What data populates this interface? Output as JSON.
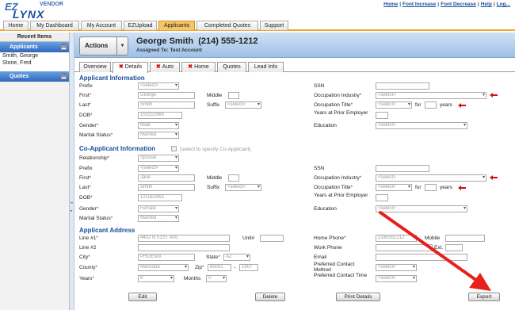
{
  "header": {
    "logo_ez": "EZ",
    "logo_lynx": "LYNX",
    "logo_vendor": "VENDOR",
    "links": [
      "Home",
      "Font Increase",
      "Font Decrease",
      "Help",
      "Log..."
    ],
    "separator": "|"
  },
  "nav": {
    "tabs": [
      "Home",
      "My Dashboard",
      "My Account",
      "EZUpload",
      "Applicants",
      "Completed Quotes",
      "Support"
    ],
    "active": "Applicants"
  },
  "sidebar": {
    "recent_title": "Recent Items",
    "applicants_label": "Applicants",
    "applicants": [
      "Smith, George",
      "Stone, Fred"
    ],
    "quotes_label": "Quotes",
    "collapse_symbol": "⊟"
  },
  "band": {
    "actions_label": "Actions",
    "dropdown_symbol": "▼",
    "client_name": "George Smith",
    "client_phone": "(214) 555-1212",
    "assigned_to": "Assigned To: Test Account"
  },
  "subtabs": {
    "tabs": [
      "Overview",
      "Details",
      "Auto",
      "Home",
      "Quotes",
      "Lead Info"
    ],
    "x_mark": "✖",
    "active": "Details"
  },
  "form": {
    "required_mark": "*",
    "applicant_title": "Applicant Information",
    "coapplicant_title": "Co-Applicant Information",
    "coapplicant_note": "(select to specify Co-Applicant)",
    "address_title": "Applicant Address",
    "labels": {
      "prefix": "Prefix",
      "first": "First",
      "middle": "Middle",
      "last": "Last",
      "suffix": "Suffix",
      "dob": "DOB",
      "gender": "Gender",
      "marital": "Marital Status",
      "ssn": "SSN",
      "occ_industry": "Occupation Industry",
      "occ_title": "Occupation Title",
      "for": "for",
      "years": "years",
      "years_prior": "Years at Prior Employer",
      "education": "Education",
      "relationship": "Relationship",
      "line1": "Line #1",
      "line2": "Line #2",
      "unit": "Unit#",
      "city": "City",
      "state": "State",
      "county": "County",
      "zip": "Zip",
      "years_addr": "Years",
      "months": "Months",
      "home_phone": "Home Phone",
      "mobile": "Mobile",
      "work_phone": "Work Phone",
      "ext": "Ext.",
      "email": "Email",
      "pref_method": "Preferred Contact Method",
      "pref_time": "Preferred Contact Time"
    },
    "applicant": {
      "prefix": "<select>",
      "first": "George",
      "middle": "",
      "last": "Smith",
      "suffix": "<select>",
      "dob": "10/22/1960",
      "gender": "Male",
      "marital": "Married",
      "ssn": "",
      "occ_industry": "<select>",
      "occ_title": "<select>",
      "years_prior": "",
      "education": "<select>"
    },
    "coapplicant": {
      "relationship": "Spouse",
      "prefix": "<select>",
      "first": "Jane",
      "middle": "",
      "last": "Smith",
      "suffix": "<select>",
      "dob": "12/16/1962",
      "gender": "Female",
      "marital": "Married",
      "ssn": "",
      "occ_industry": "<select>",
      "occ_title": "<select>",
      "education": "<select>"
    },
    "address": {
      "line1": "4402 N 51ST AVE",
      "line2": "",
      "unit": "",
      "city": "PHOENIX",
      "state": "AZ",
      "county": "Maricopa",
      "zip": "85031",
      "zip_ext": "1907",
      "years": "8",
      "months": "0",
      "home_phone": "2145551212",
      "mobile": "",
      "work_phone": "",
      "ext": "",
      "email": "",
      "pref_method": "<select>",
      "pref_time": "<select>",
      "dash": "-"
    },
    "buttons": {
      "edit": "Edit",
      "delete": "Delete",
      "print": "Print Details",
      "export": "Export"
    }
  },
  "colors": {
    "accent_orange": "#f0a630",
    "brand_blue": "#1a4e9c",
    "required_red": "#cc1111",
    "annotation_red": "#e8201c"
  }
}
